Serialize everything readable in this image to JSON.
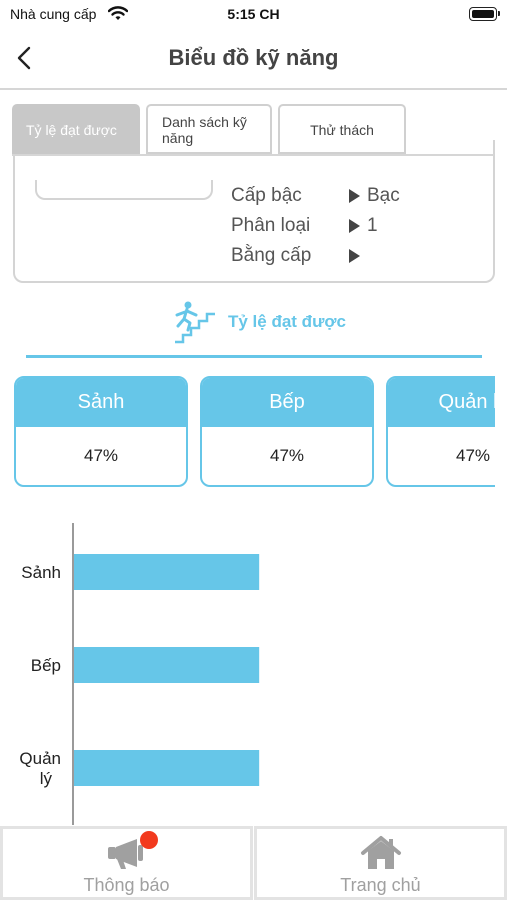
{
  "status_bar": {
    "carrier": "Nhà cung cấp",
    "time": "5:15 CH"
  },
  "header": {
    "title": "Biểu đồ kỹ năng",
    "back_icon": "chevron-left-icon"
  },
  "tabs": [
    {
      "label": "Tỷ lệ đạt được",
      "active": true
    },
    {
      "label": "Danh sách kỹ năng",
      "active": false
    },
    {
      "label": "Thử thách",
      "active": false
    }
  ],
  "info": [
    {
      "label": "Cấp bậc",
      "value": "Bạc"
    },
    {
      "label": "Phân loại",
      "value": "1"
    },
    {
      "label": "Bằng cấp",
      "value": ""
    }
  ],
  "section": {
    "title": "Tỷ lệ đạt được",
    "icon": "stairs-runner-icon"
  },
  "cards": [
    {
      "name": "Sảnh",
      "percent": "47%"
    },
    {
      "name": "Bếp",
      "percent": "47%"
    },
    {
      "name": "Quản lý",
      "percent": "47%"
    }
  ],
  "chart_data": {
    "type": "bar",
    "orientation": "horizontal",
    "categories": [
      "Sảnh",
      "Bếp",
      "Quản lý"
    ],
    "values": [
      47,
      47,
      47
    ],
    "xlim": [
      0,
      100
    ],
    "grid": false,
    "bar_color": "#66c6e8"
  },
  "bottom_nav": [
    {
      "label": "Thông báo",
      "icon": "megaphone-icon",
      "has_badge": true
    },
    {
      "label": "Trang chủ",
      "icon": "home-icon",
      "has_badge": false
    }
  ],
  "colors": {
    "accent": "#66c6e8",
    "badge": "#f23a1e",
    "tab_active": "#c8c8c8"
  }
}
